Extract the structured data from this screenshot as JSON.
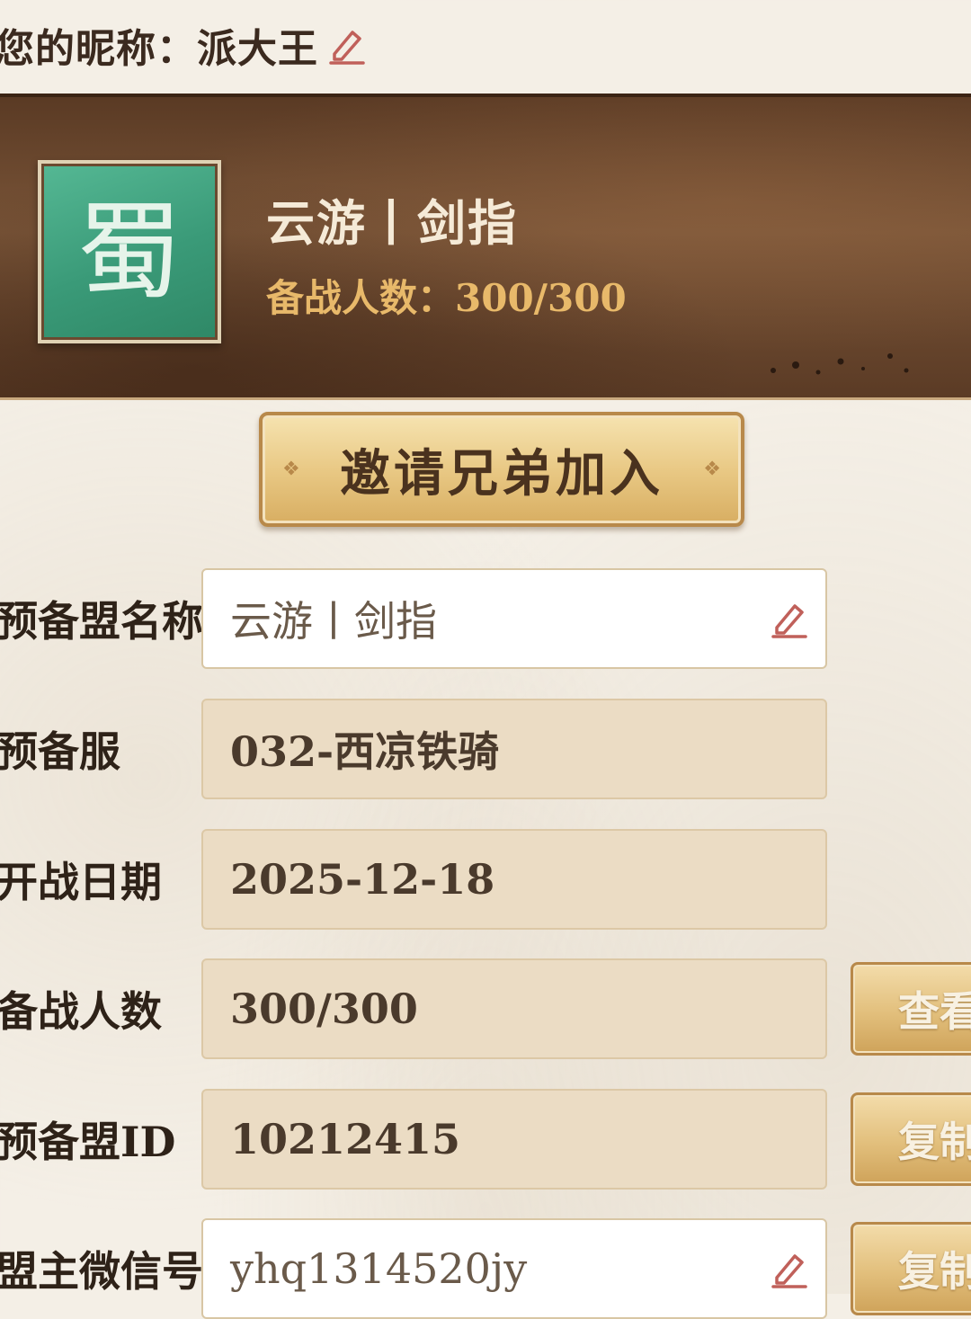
{
  "nickname": {
    "label": "您的昵称：",
    "value": "派大王"
  },
  "guild": {
    "emblem_char": "蜀",
    "name": "云游丨剑指",
    "members_label": "备战人数：",
    "members_value": "300/300"
  },
  "invite_button": {
    "label": "邀请兄弟加入"
  },
  "form": {
    "rows": [
      {
        "label": "预备盟名称",
        "value": "云游丨剑指",
        "editable": true
      },
      {
        "label": "预备服",
        "value": "032-西凉铁骑",
        "editable": false
      },
      {
        "label": "开战日期",
        "value": "2025-12-18",
        "editable": false
      },
      {
        "label": "备战人数",
        "value": "300/300",
        "editable": false,
        "action": "查看"
      },
      {
        "label": "预备盟ID",
        "value": "10212415",
        "editable": false,
        "action": "复制"
      },
      {
        "label": "盟主微信号",
        "value": "yhq1314520jy",
        "editable": true,
        "action": "复制"
      }
    ]
  },
  "icons": {
    "edit": "pencil-edit-icon"
  },
  "colors": {
    "banner_brown": "#6b4a30",
    "emblem_green": "#3a9a78",
    "gold_text": "#e8b96a",
    "edit_icon_red": "#c0605a",
    "button_gold": "#e2bf7c"
  }
}
